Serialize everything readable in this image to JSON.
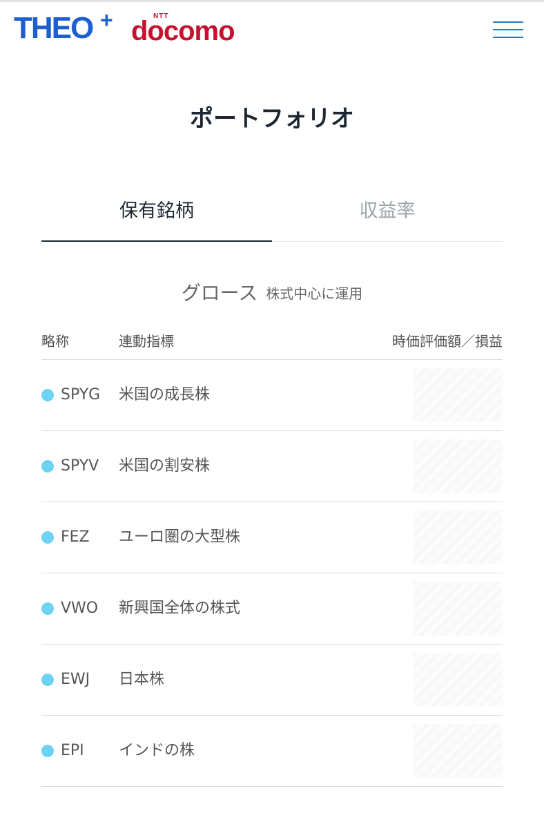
{
  "header": {
    "logo_theo": "THEO",
    "logo_plus": "+",
    "logo_ntt": "NTT",
    "logo_docomo": "docomo",
    "menu_icon": "hamburger-menu-icon"
  },
  "page": {
    "title": "ポートフォリオ"
  },
  "tabs": [
    {
      "label": "保有銘柄",
      "active": true
    },
    {
      "label": "収益率",
      "active": false
    }
  ],
  "section": {
    "name": "グロース",
    "description": "株式中心に運用"
  },
  "table": {
    "columns": {
      "abbreviation": "略称",
      "index": "連動指標",
      "value": "時価評価額／損益"
    },
    "rows": [
      {
        "ticker": "SPYG",
        "index": "米国の成長株"
      },
      {
        "ticker": "SPYV",
        "index": "米国の割安株"
      },
      {
        "ticker": "FEZ",
        "index": "ユーロ圏の大型株"
      },
      {
        "ticker": "VWO",
        "index": "新興国全体の株式"
      },
      {
        "ticker": "EWJ",
        "index": "日本株"
      },
      {
        "ticker": "EPI",
        "index": "インドの株"
      }
    ]
  },
  "colors": {
    "brand_blue": "#1d5fd0",
    "docomo_red": "#c8102e",
    "dot_color": "#6dd3f3",
    "title_color": "#1c2733"
  }
}
